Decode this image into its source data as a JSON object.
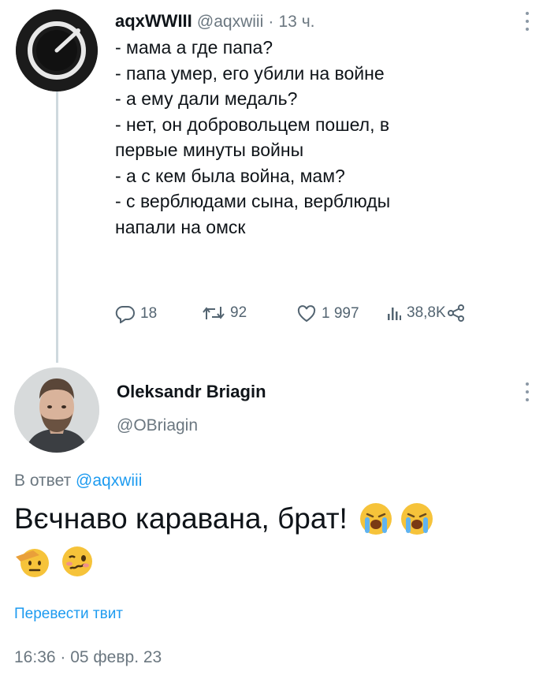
{
  "tweet1": {
    "display_name": "aqxWWIII",
    "handle": "@aqxwiii",
    "separator": "·",
    "time_ago": "13 ч.",
    "lines": [
      "- мама а где папа?",
      "- папа умер, его убили на войне",
      "- а ему дали медаль?",
      "- нет, он добровольцем пошел, в",
      "первые минуты войны",
      "- а с кем была война, мам?",
      "- с верблюдами сына, верблюды",
      "напали на омск"
    ],
    "stats": {
      "replies": "18",
      "retweets": "92",
      "likes": "1 997",
      "views": "38,8K"
    },
    "icons": [
      "reply-icon",
      "retweet-icon",
      "like-icon",
      "views-icon",
      "share-icon",
      "more-icon"
    ]
  },
  "tweet2": {
    "display_name": "Oleksandr Briagin",
    "handle": "@OBriagin",
    "reply_prefix": "В ответ",
    "reply_to": "@aqxwiii",
    "text": "Вєчнаво каравана, брат!",
    "emojis": [
      "loudly-crying-face",
      "loudly-crying-face",
      "saluting-face",
      "woozy-face"
    ],
    "translate_label": "Перевести твит",
    "timestamp": "16:36 · 05 февр. 23"
  },
  "colors": {
    "link": "#1d9bf0",
    "secondary_text": "#6b7780",
    "thread_line": "#cfd9de",
    "primary_text": "#0f1419"
  }
}
